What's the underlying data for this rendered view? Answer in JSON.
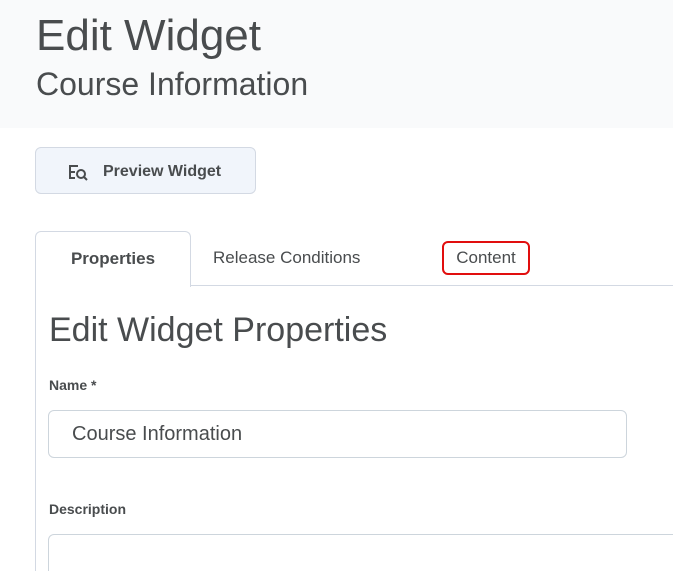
{
  "header": {
    "title": "Edit Widget",
    "subtitle": "Course Information"
  },
  "toolbar": {
    "preview_label": "Preview Widget",
    "preview_icon": "preview-search-icon"
  },
  "tabs": [
    {
      "label": "Properties",
      "active": true
    },
    {
      "label": "Release Conditions",
      "active": false
    },
    {
      "label": "Content",
      "active": false,
      "highlighted": true
    }
  ],
  "form": {
    "section_title": "Edit Widget Properties",
    "name_label": "Name",
    "name_required_mark": "*",
    "name_value": "Course Information",
    "description_label": "Description",
    "description_value": ""
  },
  "colors": {
    "highlight": "#e10e0e",
    "text": "#494c4e",
    "border": "#d3d9e3",
    "header_bg": "#f9fafb"
  }
}
